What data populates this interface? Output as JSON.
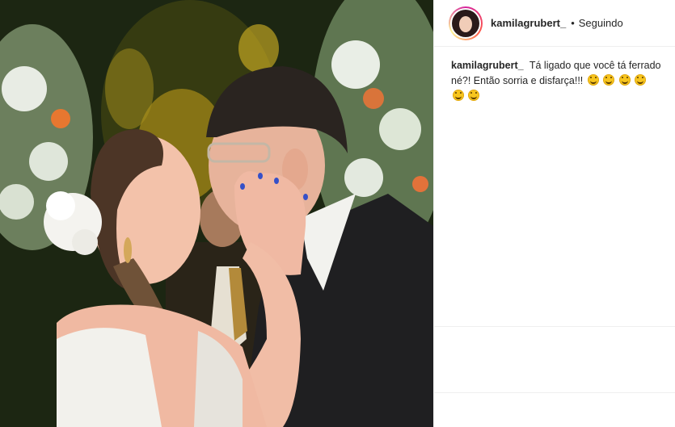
{
  "post": {
    "image_description_icon": "photo",
    "author": {
      "username": "kamilagrubert_",
      "follow_status": "Seguindo",
      "separator": "•"
    },
    "caption": {
      "username": "kamilagrubert_",
      "text": "Tá ligado que você tá ferrado né?! Então sorria e disfarça!!!",
      "emoji_count": 6,
      "emoji_icon": "grinning-sweat-emoji"
    }
  },
  "colors": {
    "text": "#262626",
    "border": "#efefef",
    "avatar_ring": "#d6249f"
  }
}
